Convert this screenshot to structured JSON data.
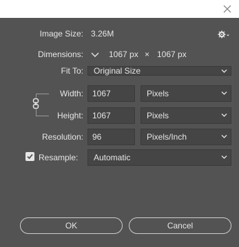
{
  "window": {
    "close_icon": "close-icon"
  },
  "dialog": {
    "image_size": {
      "label": "Image Size:",
      "value": "3.26M"
    },
    "settings_icon": "gear-icon",
    "dimensions": {
      "label": "Dimensions:",
      "width": "1067 px",
      "times": "×",
      "height": "1067 px"
    },
    "fit_to": {
      "label": "Fit To:",
      "value": "Original Size"
    },
    "width": {
      "label": "Width:",
      "value": "1067",
      "unit": "Pixels"
    },
    "height": {
      "label": "Height:",
      "value": "1067",
      "unit": "Pixels"
    },
    "resolution": {
      "label": "Resolution:",
      "value": "96",
      "unit": "Pixels/Inch"
    },
    "resample": {
      "label": "Resample:",
      "checked": true,
      "value": "Automatic"
    },
    "ok_label": "OK",
    "cancel_label": "Cancel"
  },
  "colors": {
    "dialog_bg": "#535353",
    "field_bg": "#454545",
    "text": "#e6e6e6"
  }
}
